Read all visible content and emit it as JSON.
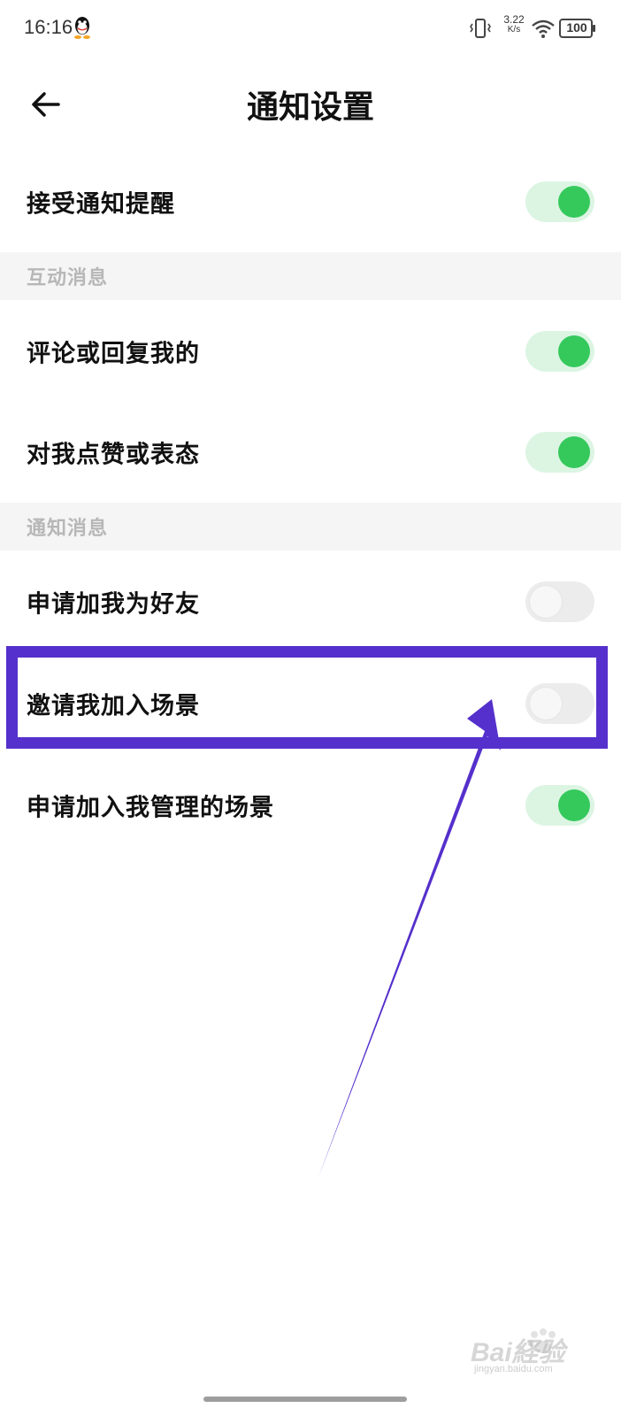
{
  "status_bar": {
    "time": "16:16",
    "net_speed_value": "3.22",
    "net_speed_unit": "K/s",
    "battery": "100",
    "icons": [
      "qq-icon",
      "vibrate-icon",
      "wifi-icon",
      "battery-icon"
    ]
  },
  "header": {
    "title": "通知设置",
    "back_icon": "back-arrow-icon"
  },
  "rows": {
    "accept_notifications": {
      "label": "接受通知提醒",
      "enabled": true
    },
    "comment_reply": {
      "label": "评论或回复我的",
      "enabled": true
    },
    "like_reaction": {
      "label": "对我点赞或表态",
      "enabled": true
    },
    "friend_request": {
      "label": "申请加我为好友",
      "enabled": false
    },
    "scene_invite": {
      "label": "邀请我加入场景",
      "enabled": false
    },
    "scene_join_request": {
      "label": "申请加入我管理的场景",
      "enabled": true
    }
  },
  "sections": {
    "interaction": "互动消息",
    "notification": "通知消息"
  },
  "colors": {
    "toggle_on_track": "#dcf5e3",
    "toggle_on_knob": "#35c95c",
    "toggle_off_track": "#ececec",
    "annotation": "#5530cc"
  },
  "watermark": {
    "text": "Bai経验",
    "sub": "jingyan.baidu.com"
  }
}
